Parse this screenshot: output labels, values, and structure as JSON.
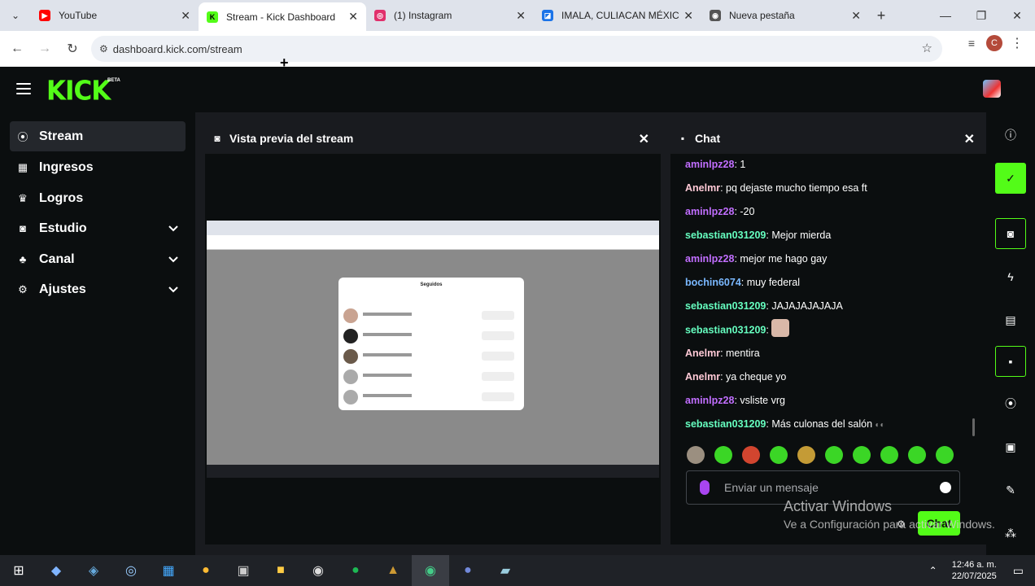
{
  "browser": {
    "tabs": [
      {
        "title": "YouTube",
        "icon": "youtube-icon",
        "color": "#ff0000"
      },
      {
        "title": "Stream - Kick Dashboard",
        "icon": "kick-icon",
        "color": "#53fc18"
      },
      {
        "title": "(1) Instagram",
        "icon": "instagram-icon",
        "color": "#e1306c"
      },
      {
        "title": "IMALA, CULIACAN MÉXICO",
        "icon": "page-icon",
        "color": "#1a73e8"
      },
      {
        "title": "Nueva pestaña",
        "icon": "chrome-icon",
        "color": "#555555"
      }
    ],
    "url": "dashboard.kick.com/stream",
    "profile_initial": "C"
  },
  "kick": {
    "logo": "KICK",
    "beta": "BETA",
    "accent": "#53fc18"
  },
  "sidebar": {
    "items": [
      {
        "label": "Stream",
        "icon": "stream-icon"
      },
      {
        "label": "Ingresos",
        "icon": "income-icon"
      },
      {
        "label": "Logros",
        "icon": "trophy-icon"
      },
      {
        "label": "Estudio",
        "icon": "studio-icon"
      },
      {
        "label": "Canal",
        "icon": "channel-icon"
      },
      {
        "label": "Ajustes",
        "icon": "settings-icon"
      }
    ]
  },
  "preview": {
    "title": "Vista previa del stream",
    "modal_title": "Seguidos"
  },
  "chat": {
    "title": "Chat",
    "messages": [
      {
        "user": "aminlpz28",
        "color": "#c16eff",
        "text": ": 1"
      },
      {
        "user": "Anelmr",
        "color": "#ffc9d6",
        "text": ": pq dejaste mucho tiempo esa ft"
      },
      {
        "user": "aminlpz28",
        "color": "#c16eff",
        "text": ": -20"
      },
      {
        "user": "sebastian031209",
        "color": "#66ffc0",
        "text": ": Mejor mierda"
      },
      {
        "user": "aminlpz28",
        "color": "#c16eff",
        "text": ": mejor me hago gay"
      },
      {
        "user": "bochin6074",
        "color": "#7ab8ff",
        "text": ": muy federal"
      },
      {
        "user": "sebastian031209",
        "color": "#66ffc0",
        "text": ": JAJAJAJAJAJA"
      },
      {
        "user": "sebastian031209",
        "color": "#66ffc0",
        "text": ":"
      },
      {
        "user": "Anelmr",
        "color": "#ffc9d6",
        "text": ": mentira"
      },
      {
        "user": "Anelmr",
        "color": "#ffc9d6",
        "text": ": ya cheque yo"
      },
      {
        "user": "aminlpz28",
        "color": "#c16eff",
        "text": ": vsliste vrg"
      },
      {
        "user": "sebastian031209",
        "color": "#66ffc0",
        "text": ": Más culonas del salón"
      }
    ],
    "input_placeholder": "Enviar un mensaje",
    "send_label": "Chat"
  },
  "watermark": {
    "line1": "Activar Windows",
    "line2": "Ve a Configuración para activar Windows."
  },
  "taskbar": {
    "time": "12:46 a. m.",
    "date": "22/07/2025"
  }
}
